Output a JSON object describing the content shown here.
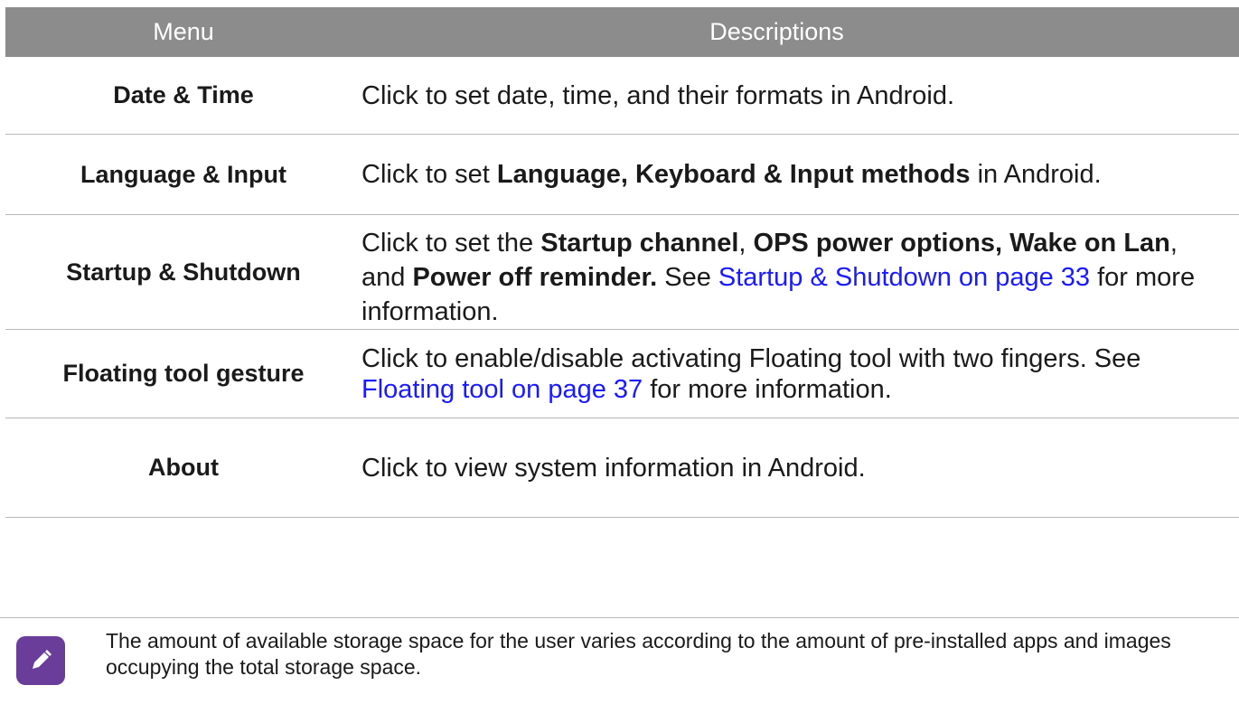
{
  "table": {
    "header": {
      "menu": "Menu",
      "descriptions": "Descriptions"
    },
    "rows": [
      {
        "menu": "Date & Time",
        "desc": [
          {
            "t": "Click to set date, time, and their formats in Android."
          }
        ]
      },
      {
        "menu": "Language & Input",
        "desc": [
          {
            "t": "Click to set "
          },
          {
            "t": "Language, Keyboard & Input methods",
            "bold": true
          },
          {
            "t": " in Android."
          }
        ]
      },
      {
        "menu": "Startup & Shutdown",
        "desc": [
          {
            "t": "Click to set the "
          },
          {
            "t": "Startup channel",
            "bold": true
          },
          {
            "t": ", "
          },
          {
            "t": "OPS power options, Wake on Lan",
            "bold": true
          },
          {
            "t": ", and "
          },
          {
            "t": "Power off reminder.",
            "bold": true
          },
          {
            "t": " See "
          },
          {
            "t": "Startup & Shutdown on page 33",
            "link": true
          },
          {
            "t": " for more information."
          }
        ]
      },
      {
        "menu": "Floating tool gesture",
        "desc": [
          {
            "t": "Click to enable/disable activating Floating tool with two fingers. See "
          },
          {
            "t": "Floating tool on page 37",
            "link": true
          },
          {
            "t": " for more information."
          }
        ]
      },
      {
        "menu": "About",
        "desc": [
          {
            "t": "Click to view system information in Android."
          }
        ]
      }
    ]
  },
  "note": {
    "icon": "pencil-icon",
    "text": "The amount of available storage space for the user varies according to the amount of pre-installed apps and images occupying the total storage space.",
    "icon_color": "#6a3d9a"
  },
  "colors": {
    "header_bg": "#8c8c8c",
    "link": "#1a1aff",
    "divider": "#b8b8b8"
  }
}
